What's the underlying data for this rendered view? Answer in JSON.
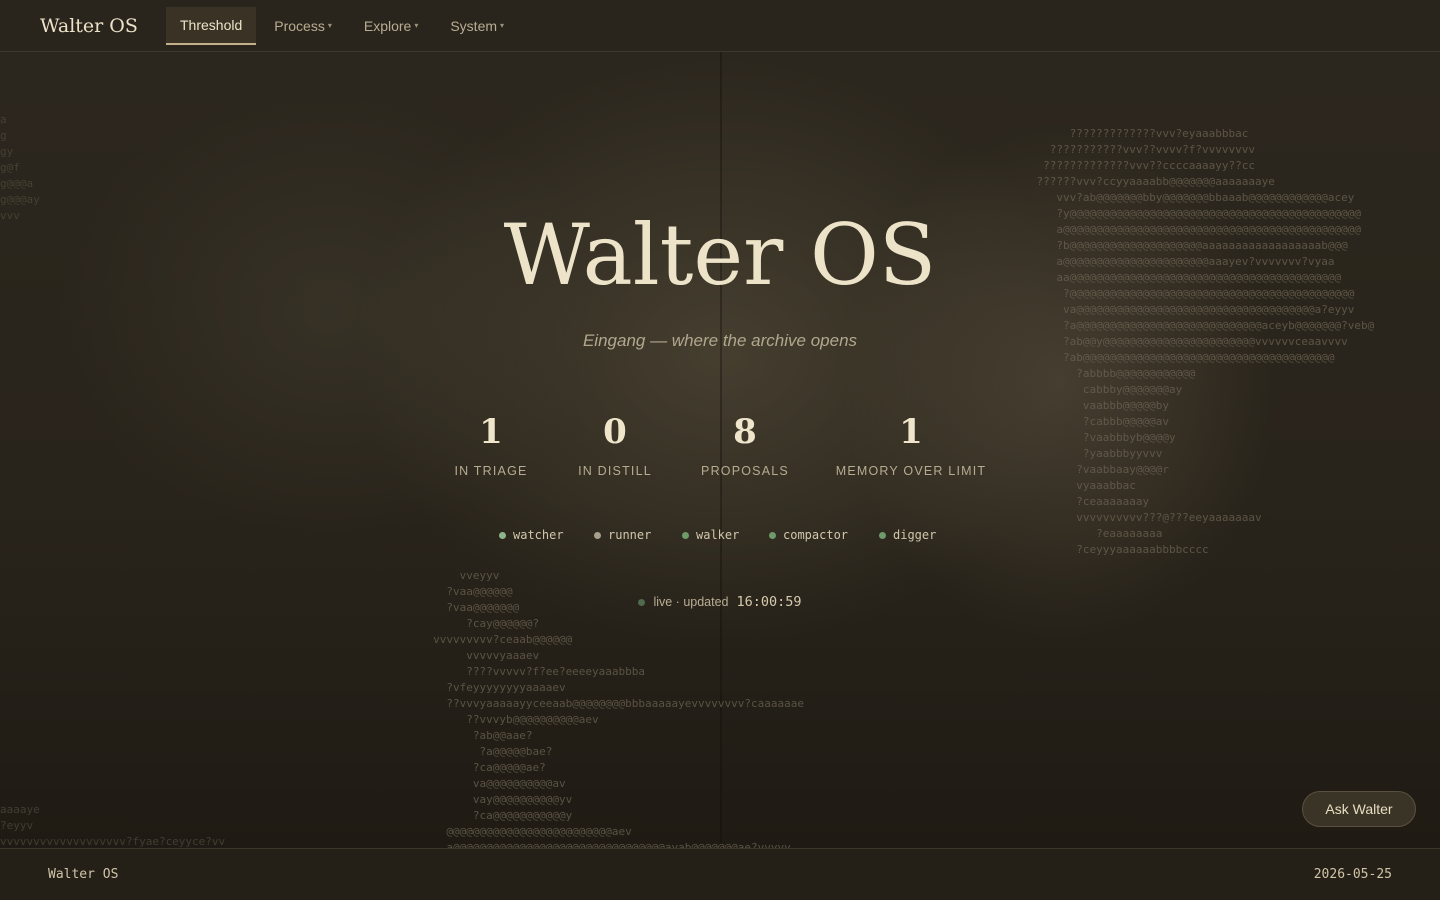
{
  "brand": "Walter OS",
  "nav": [
    {
      "label": "Threshold",
      "active": true,
      "has_menu": false
    },
    {
      "label": "Process",
      "active": false,
      "has_menu": true
    },
    {
      "label": "Explore",
      "active": false,
      "has_menu": true
    },
    {
      "label": "System",
      "active": false,
      "has_menu": true
    }
  ],
  "hero": {
    "title": "Walter OS",
    "tagline": "Eingang — where the archive opens"
  },
  "stats": [
    {
      "value": "1",
      "label": "IN TRIAGE"
    },
    {
      "value": "0",
      "label": "IN DISTILL"
    },
    {
      "value": "8",
      "label": "PROPOSALS"
    },
    {
      "value": "1",
      "label": "MEMORY OVER LIMIT"
    }
  ],
  "agents": [
    {
      "name": "watcher",
      "status_color": "#8fb58a"
    },
    {
      "name": "runner",
      "status_color": "#a8a08c"
    },
    {
      "name": "walker",
      "status_color": "#6f9a6a"
    },
    {
      "name": "compactor",
      "status_color": "#6f9a6a"
    },
    {
      "name": "digger",
      "status_color": "#6f9a6a"
    }
  ],
  "live": {
    "text": "live · updated",
    "time": "16:00:59"
  },
  "ask_button": "Ask Walter",
  "footer": {
    "left": "Walter OS",
    "right": "2026-05-25"
  },
  "colors": {
    "background": "#221e16",
    "accent": "#c2b08a",
    "text": "#ede3c8",
    "live_dot": "#4f6a4c"
  },
  "icons": {
    "nav_caret": "chevron-down-icon",
    "agent_status": "status-dot-icon",
    "live_indicator": "live-dot-icon"
  }
}
